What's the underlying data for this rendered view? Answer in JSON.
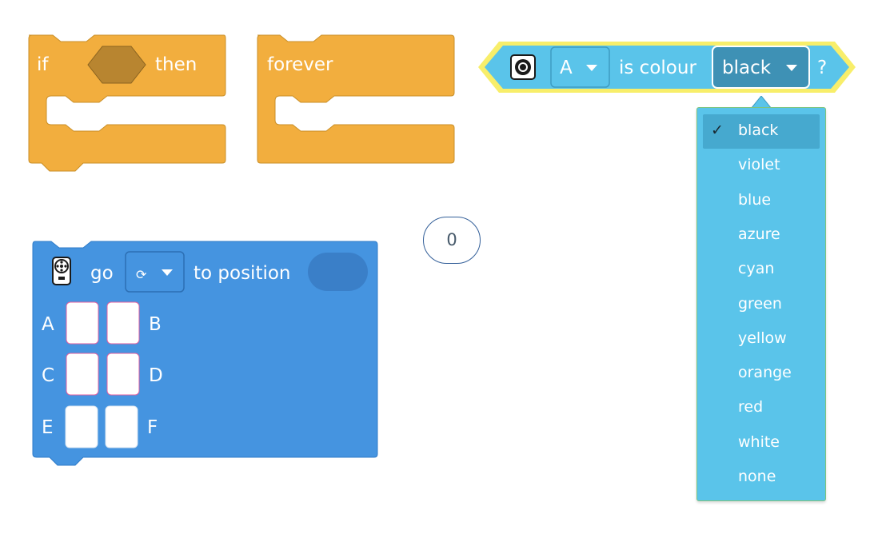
{
  "if_block": {
    "if_label": "if",
    "then_label": "then"
  },
  "forever_block": {
    "label": "forever"
  },
  "colour_block": {
    "port": "A",
    "label": "is colour",
    "value": "black",
    "suffix": "?"
  },
  "colour_menu": {
    "items": [
      "black",
      "violet",
      "blue",
      "azure",
      "cyan",
      "green",
      "yellow",
      "orange",
      "red",
      "white",
      "none"
    ],
    "selected": "black",
    "check": "✓"
  },
  "number_bubble": {
    "value": "0"
  },
  "motor_block": {
    "label_go": "go",
    "direction_icon": "⟳",
    "label_to_position": "to position",
    "ports": [
      "A",
      "B",
      "C",
      "D",
      "E",
      "F"
    ]
  },
  "colors": {
    "control_orange": "#f2ae3e",
    "sensor_blue": "#5ac4ea",
    "motor_blue": "#4594e0",
    "highlight_yellow": "#f8ee6a",
    "dropdown_dark": "#3e91b5"
  }
}
